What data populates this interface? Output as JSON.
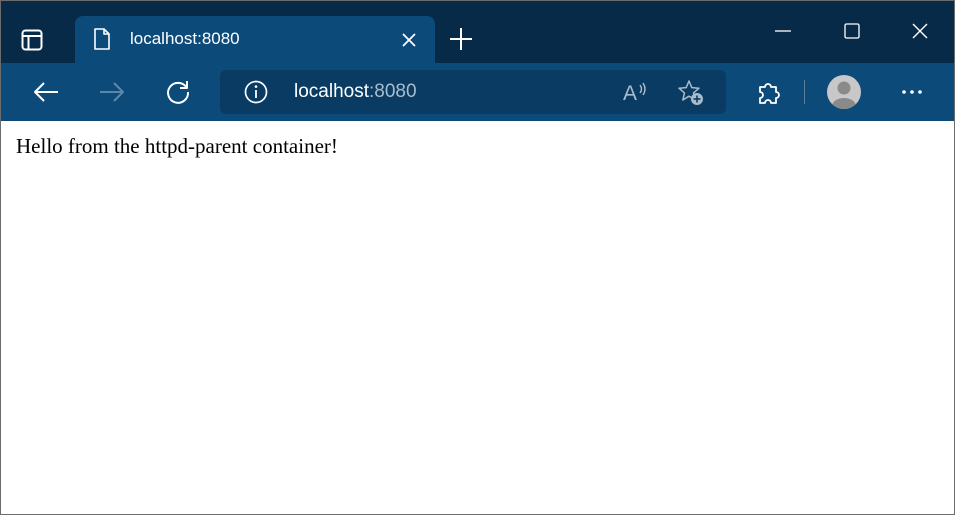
{
  "browser": {
    "tab": {
      "title": "localhost:8080"
    },
    "address_bar": {
      "host": "localhost",
      "port": ":8080"
    },
    "theme": {
      "titlebar_bg": "#072a48",
      "toolbar_bg": "#0c4a7a",
      "addressbar_bg": "#0a3b63"
    }
  },
  "page": {
    "body_text": "Hello from the httpd-parent container!"
  }
}
